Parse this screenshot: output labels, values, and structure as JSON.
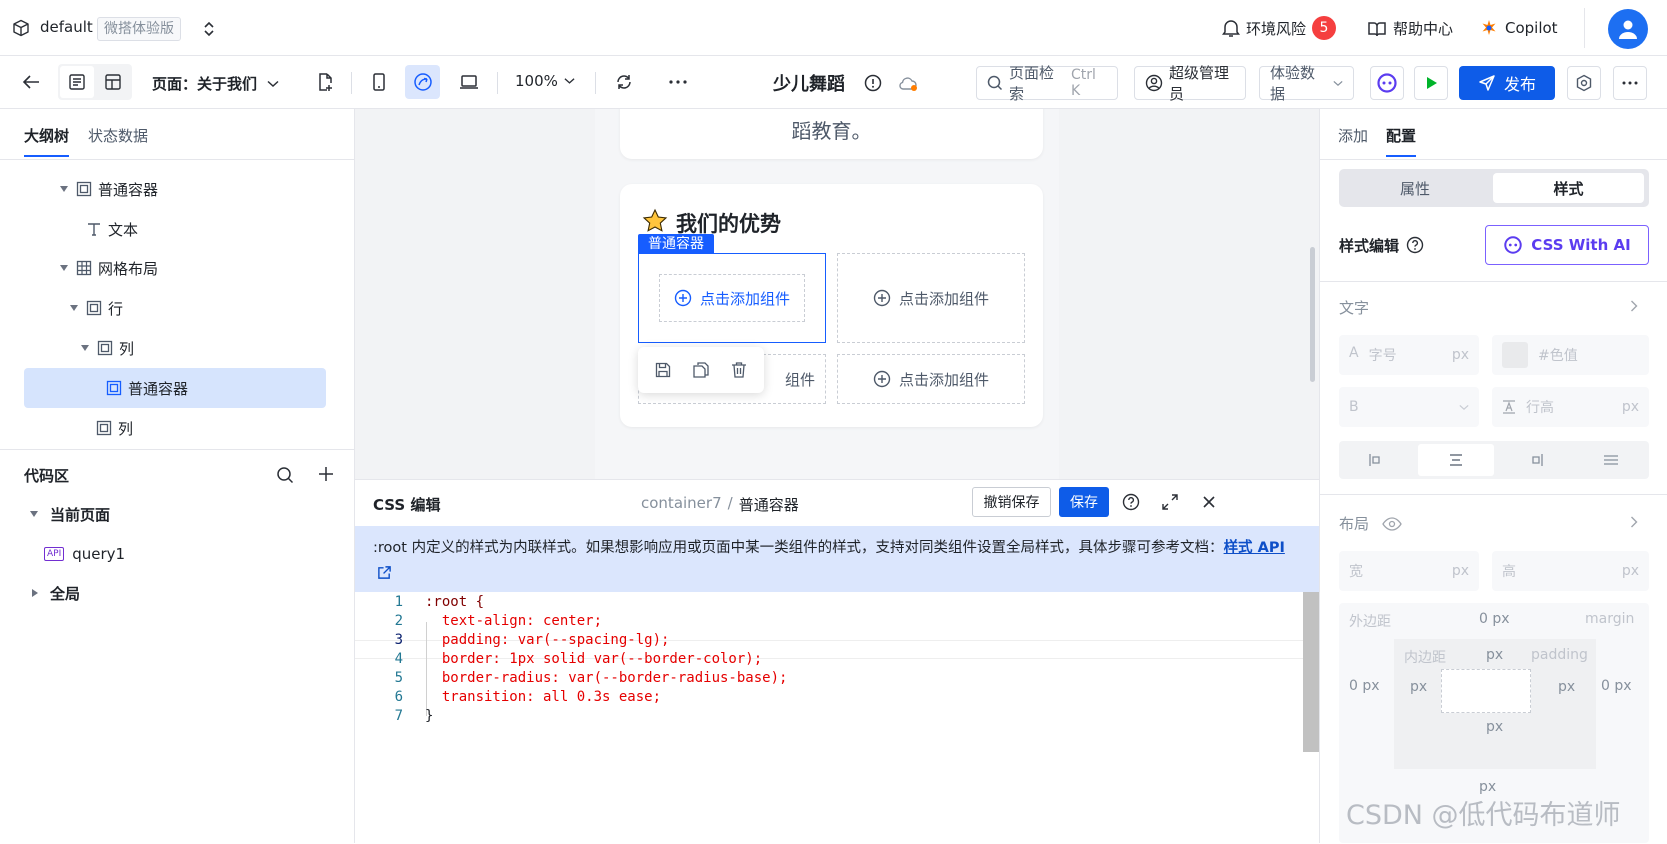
{
  "app": {
    "workspace": "default",
    "edition_badge": "微搭体验版",
    "env_risk_label": "环境风险",
    "env_risk_count": "5",
    "help_label": "帮助中心",
    "copilot_label": "Copilot"
  },
  "toolbar": {
    "page_label": "页面：关于我们",
    "zoom": "100%",
    "app_name": "少儿舞蹈",
    "search_placeholder": "页面检索",
    "search_shortcut": "Ctrl K",
    "admin_label": "超级管理员",
    "data_label": "体验数据",
    "publish_label": "发布"
  },
  "outline": {
    "tabs": [
      "大纲树",
      "状态数据"
    ],
    "items": [
      {
        "label": "普通容器",
        "depth": 0,
        "icon": "container",
        "caret": "open"
      },
      {
        "label": "文本",
        "depth": 1,
        "icon": "text",
        "caret": "none"
      },
      {
        "label": "网格布局",
        "depth": 0,
        "icon": "grid",
        "caret": "open"
      },
      {
        "label": "行",
        "depth": 1,
        "icon": "container",
        "caret": "open"
      },
      {
        "label": "列",
        "depth": 2,
        "icon": "container",
        "caret": "open"
      },
      {
        "label": "普通容器",
        "depth": 3,
        "icon": "container",
        "caret": "none",
        "selected": true
      },
      {
        "label": "列",
        "depth": 2,
        "icon": "container",
        "caret": "none"
      },
      {
        "label": "行",
        "depth": 1,
        "icon": "container",
        "caret": "none"
      }
    ]
  },
  "code_area": {
    "title": "代码区",
    "current_page_label": "当前页面",
    "query_label": "query1",
    "global_label": "全局"
  },
  "canvas": {
    "text_fragment": "蹈教育。",
    "section_title": "我们的优势",
    "selected_tag": "普通容器",
    "add_component_label": "点击添加组件"
  },
  "css_editor": {
    "title": "CSS 编辑",
    "breadcrumb_parent": "container7",
    "breadcrumb_sep": "/",
    "breadcrumb_current": "普通容器",
    "revert_label": "撤销保存",
    "save_label": "保存",
    "notice": ":root 内定义的样式为内联样式。如果想影响应用或页面中某一类组件的样式，支持对同类组件设置全局样式，具体步骤可参考文档：",
    "notice_link": "样式 API",
    "lines": [
      ":root {",
      "  text-align: center;",
      "  padding: var(--spacing-lg);",
      "  border: 1px solid var(--border-color);",
      "  border-radius: var(--border-radius-base);",
      "  transition: all 0.3s ease;",
      "}"
    ]
  },
  "right_panel": {
    "tabs": [
      "添加",
      "配置"
    ],
    "segments": [
      "属性",
      "样式"
    ],
    "style_edit_label": "样式编辑",
    "ai_button": "CSS With AI",
    "text_section": "文字",
    "font_size_prefix": "A",
    "font_size_placeholder": "字号",
    "unit_px": "px",
    "color_placeholder": "#色值",
    "bold_prefix": "B",
    "line_height_placeholder": "行高",
    "layout_section": "布局",
    "width_label": "宽",
    "height_label": "高",
    "margin_label": "外边距",
    "margin_en": "margin",
    "padding_label": "内边距",
    "padding_en": "padding",
    "zero_px": "0 px",
    "watermark": "CSDN @低代码布道师"
  }
}
